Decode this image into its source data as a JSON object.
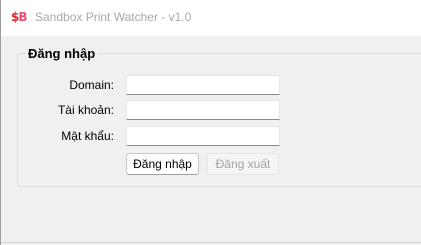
{
  "window": {
    "title": "Sandbox Print Watcher - v1.0",
    "icon": {
      "name": "sandbox-logo-icon",
      "text_s": "$",
      "text_b": "B",
      "colors": [
        "#e0262e",
        "#e8507a"
      ]
    }
  },
  "login_group": {
    "title": "Đăng nhập",
    "fields": {
      "domain": {
        "label": "Domain:",
        "value": ""
      },
      "account": {
        "label": "Tài khoản:",
        "value": ""
      },
      "password": {
        "label": "Mật khẩu:",
        "value": ""
      }
    },
    "buttons": {
      "login": {
        "label": "Đăng nhập",
        "enabled": true
      },
      "logout": {
        "label": "Đăng xuất",
        "enabled": false
      }
    }
  }
}
